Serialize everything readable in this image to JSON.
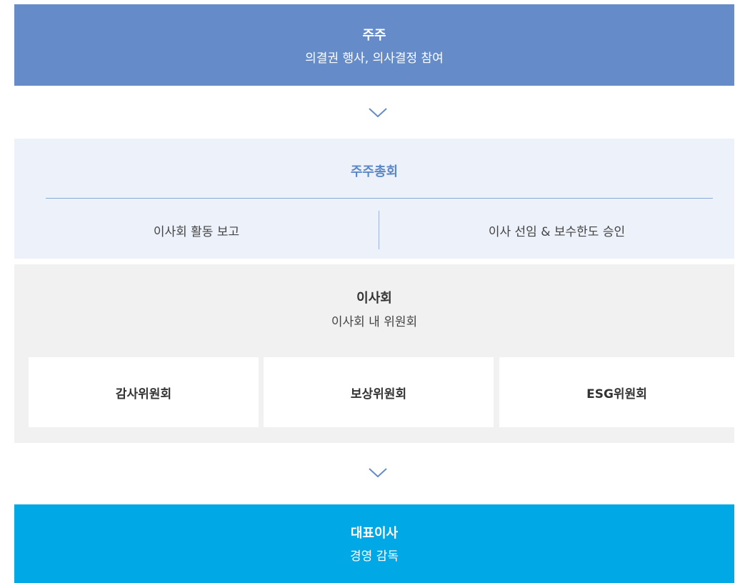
{
  "shareholder": {
    "title": "주주",
    "subtitle": "의결권 행사, 의사결정 참여"
  },
  "general_meeting": {
    "title": "주주총회",
    "items": [
      {
        "label": "이사회 활동 보고"
      },
      {
        "label": "이사 선임 & 보수한도 승인"
      }
    ]
  },
  "board": {
    "title": "이사회",
    "subtitle": "이사회 내 위원회",
    "committees": [
      {
        "label": "감사위원회"
      },
      {
        "label": "보상위원회"
      },
      {
        "label": "ESG위원회"
      }
    ]
  },
  "ceo": {
    "title": "대표이사",
    "subtitle": "경영 감독"
  },
  "icons": {
    "arrow": "chevron-down-icon"
  },
  "colors": {
    "shareholder_bg": "#658cc9",
    "meeting_bg": "#ecf1fa",
    "meeting_title": "#5b87c7",
    "board_bg": "#f1f1f1",
    "ceo_bg": "#00a8e6",
    "arrow": "#658cc9"
  }
}
